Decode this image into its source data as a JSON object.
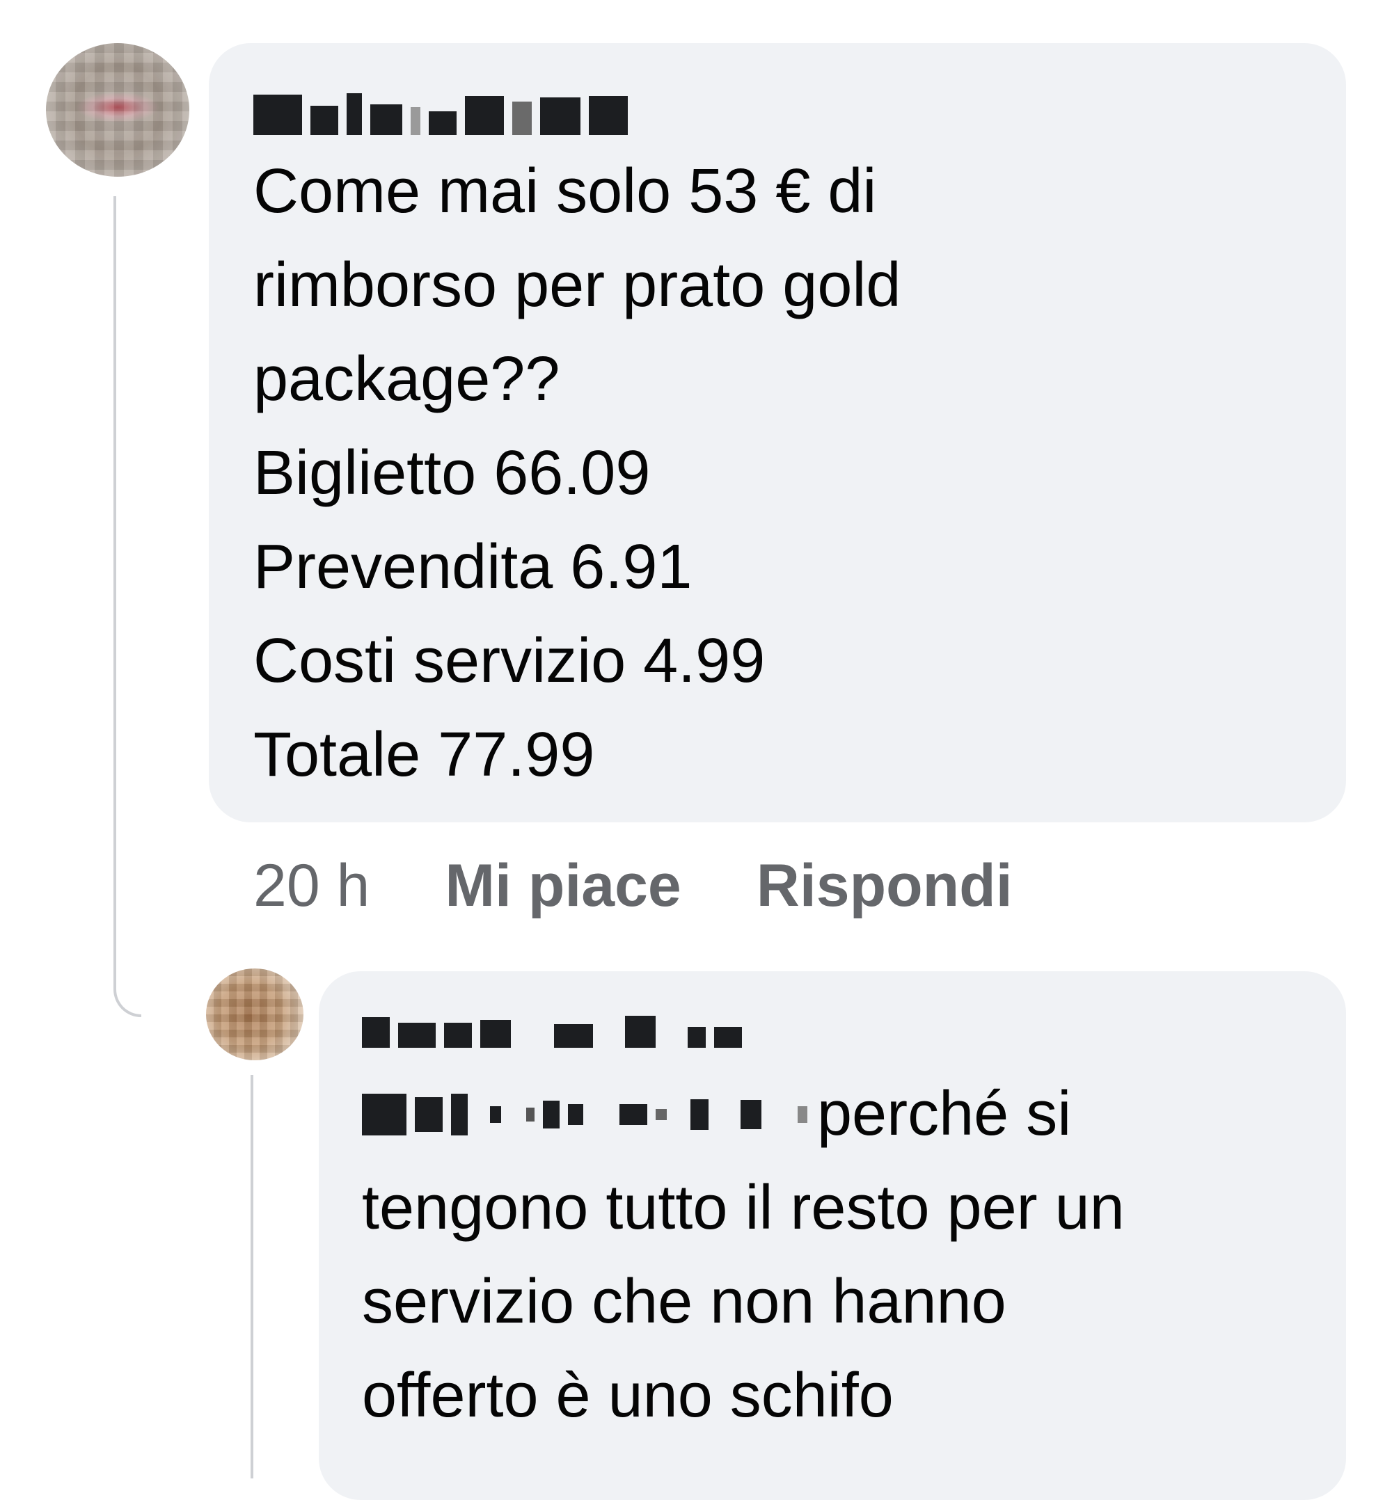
{
  "comment": {
    "author_name": "",
    "lines": [
      "Come mai solo 53 € di",
      "rimborso per prato gold",
      "package??",
      "Biglietto 66.09",
      "Prevendita 6.91",
      "Costi servizio 4.99",
      "Totale 77.99"
    ],
    "time": "20 h",
    "like_label": "Mi piace",
    "reply_label": "Rispondi"
  },
  "reply": {
    "author_name": "",
    "first_line_visible": "perché si",
    "lines": [
      "tengono tutto il resto per un",
      "servizio che non hanno",
      "offerto è uno schifo"
    ]
  }
}
